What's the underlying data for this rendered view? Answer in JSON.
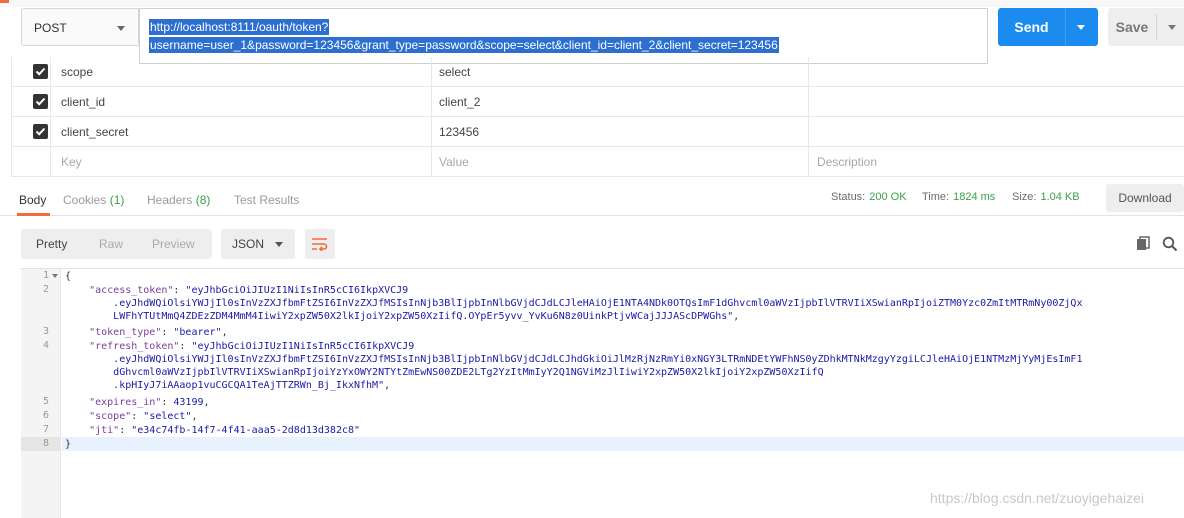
{
  "request": {
    "method": "POST",
    "url_line1": "http://localhost:8111/oauth/token?",
    "url_line2": "username=user_1&password=123456&grant_type=password&scope=select&client_id=client_2&client_secret=123456",
    "send_label": "Send",
    "save_label": "Save"
  },
  "params": [
    {
      "key": "scope",
      "value": "select",
      "checked": true
    },
    {
      "key": "client_id",
      "value": "client_2",
      "checked": true
    },
    {
      "key": "client_secret",
      "value": "123456",
      "checked": true
    }
  ],
  "params_placeholder": {
    "key": "Key",
    "value": "Value",
    "description": "Description"
  },
  "response_tabs": {
    "body": "Body",
    "cookies": "Cookies",
    "cookies_count": "(1)",
    "headers": "Headers",
    "headers_count": "(8)",
    "test_results": "Test Results"
  },
  "status": {
    "status_label": "Status:",
    "status_value": "200 OK",
    "time_label": "Time:",
    "time_value": "1824 ms",
    "size_label": "Size:",
    "size_value": "1.04 KB",
    "download_label": "Download"
  },
  "view": {
    "pretty": "Pretty",
    "raw": "Raw",
    "preview": "Preview",
    "format": "JSON"
  },
  "line_numbers": [
    "1",
    "2",
    "3",
    "4",
    "5",
    "6",
    "7",
    "8"
  ],
  "code": {
    "l1": "{",
    "access_key": "\"access_token\"",
    "access_v1": "\"eyJhbGciOiJIUzI1NiIsInR5cCI6IkpXVCJ9",
    "access_v2": ".eyJhdWQiOlsiYWJjIl0sInVzZXJfbmFtZSI6InVzZXJfMSIsInNjb3BlIjpbInNlbGVjdCJdLCJleHAiOjE1NTA4NDk0OTQsImF1dGhvcml0aWVzIjpbIlVTRVIiXSwianRpIjoiZTM0Yzc0ZmItMTRmNy00ZjQx",
    "access_v3": "LWFhYTUtMmQ4ZDEzZDM4MmM4IiwiY2xpZW50X2lkIjoiY2xpZW50XzIifQ.OYpEr5yvv_YvKu6N8z0UinkPtjvWCajJJJAScDPWGhs\"",
    "token_type_key": "\"token_type\"",
    "token_type_val": "\"bearer\"",
    "refresh_key": "\"refresh_token\"",
    "refresh_v1": "\"eyJhbGciOiJIUzI1NiIsInR5cCI6IkpXVCJ9",
    "refresh_v2": ".eyJhdWQiOlsiYWJjIl0sInVzZXJfbmFtZSI6InVzZXJfMSIsInNjb3BlIjpbInNlbGVjdCJdLCJhdGkiOiJlMzRjNzRmYi0xNGY3LTRmNDEtYWFhNS0yZDhkMTNkMzgyYzgiLCJleHAiOjE1NTMzMjYyMjEsImF1",
    "refresh_v3": "dGhvcml0aWVzIjpbIlVTRVIiXSwianRpIjoiYzYxOWY2NTYtZmEwNS00ZDE2LTg2YzItMmIyY2Q1NGViMzJlIiwiY2xpZW50X2lkIjoiY2xpZW50XzIifQ",
    "refresh_v4": ".kpHIyJ7iAAaop1vuCGCQA1TeAjTTZRWn_Bj_IkxNfhM\"",
    "expires_key": "\"expires_in\"",
    "expires_val": "43199",
    "scope_key": "\"scope\"",
    "scope_val": "\"select\"",
    "jti_key": "\"jti\"",
    "jti_val": "\"e34c74fb-14f7-4f41-aaa5-2d8d13d382c8\"",
    "l8": "}"
  },
  "watermark": "https://blog.csdn.net/zuoyigehaizei",
  "colors": {
    "accent": "#1c8bf0",
    "tab_underline": "#f26b3a",
    "success": "#3aa04a"
  }
}
